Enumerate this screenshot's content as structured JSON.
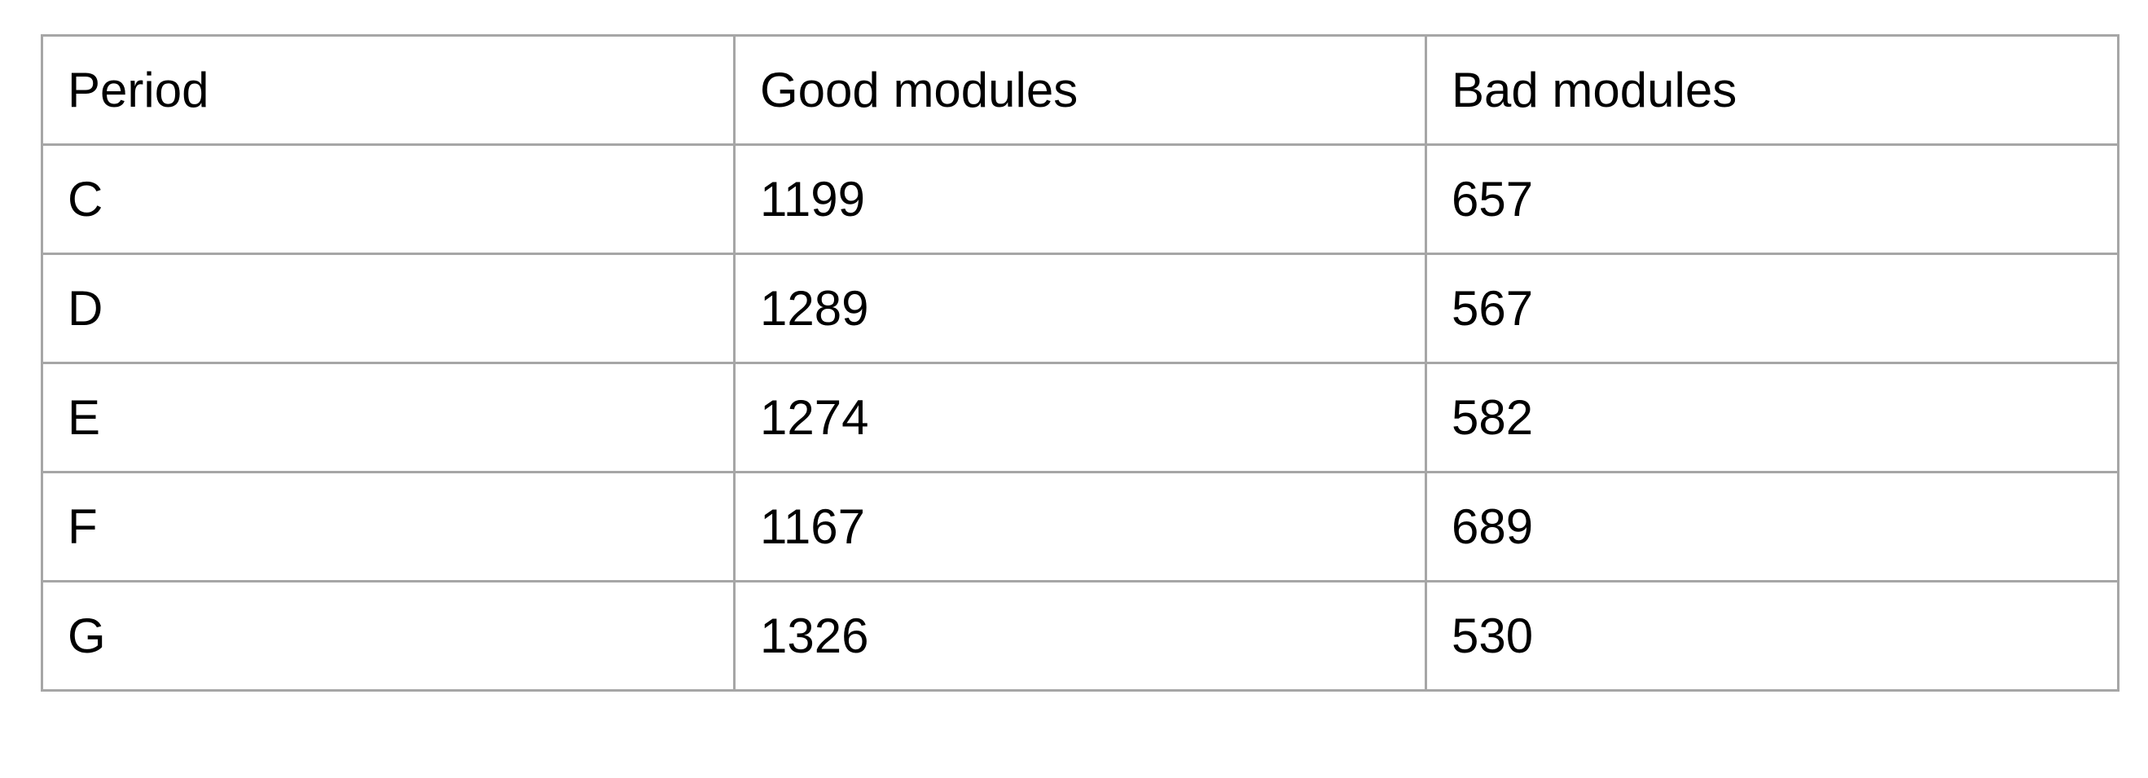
{
  "chart_data": {
    "type": "table",
    "columns": [
      "Period",
      "Good modules",
      "Bad modules"
    ],
    "rows": [
      [
        "C",
        "1199",
        "657"
      ],
      [
        "D",
        "1289",
        "567"
      ],
      [
        "E",
        "1274",
        "582"
      ],
      [
        "F",
        "1167",
        "689"
      ],
      [
        "G",
        "1326",
        "530"
      ]
    ]
  },
  "colors": {
    "border": "#a6a6a6",
    "text": "#000000",
    "background": "#ffffff"
  }
}
